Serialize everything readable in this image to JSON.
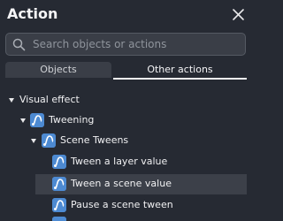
{
  "dialog": {
    "title": "Action"
  },
  "search": {
    "placeholder": "Search objects or actions",
    "value": ""
  },
  "tabs": {
    "objects": "Objects",
    "other_actions": "Other actions",
    "active": "Other actions"
  },
  "tree": {
    "visual_effect": "Visual effect",
    "tweening": "Tweening",
    "scene_tweens": "Scene Tweens",
    "tween_layer_value": "Tween a layer value",
    "tween_scene_value": "Tween a scene value",
    "pause_scene_tween": "Pause a scene tween",
    "selected": "Tween a scene value"
  },
  "colors": {
    "background": "#262a33",
    "input_background": "#3a3e47",
    "selected_row": "#3c4049",
    "icon_blue": "#4d8ad2",
    "text": "#f1f1f3"
  },
  "icons": {
    "close": "close-icon",
    "search": "search-icon",
    "tween": "tween-curve-icon",
    "expand": "chevron-down-icon"
  }
}
